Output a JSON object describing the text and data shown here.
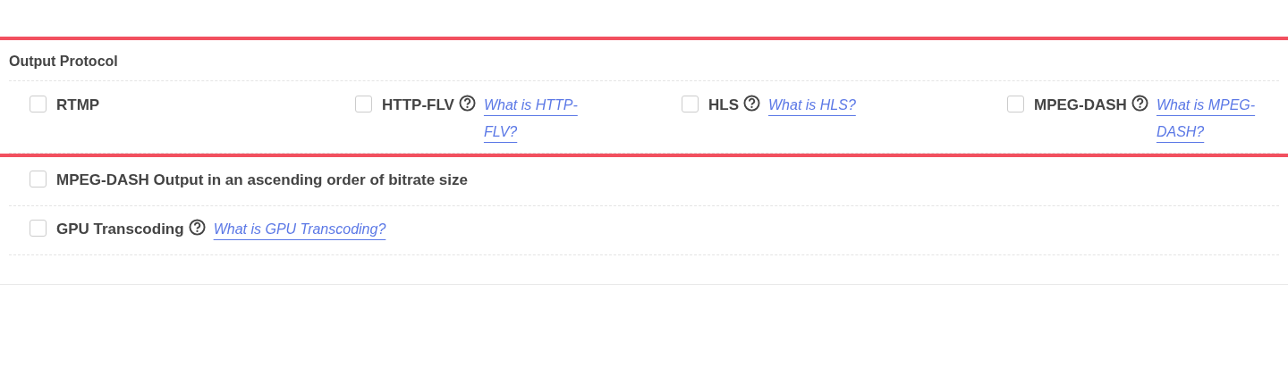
{
  "output_protocol": {
    "title": "Output Protocol",
    "protocols": [
      {
        "label": "RTMP",
        "checked": false
      },
      {
        "label": "HTTP-FLV",
        "checked": false,
        "help_link": "What is HTTP-FLV?"
      },
      {
        "label": "HLS",
        "checked": false,
        "help_link": "What is HLS?"
      },
      {
        "label": "MPEG-DASH",
        "checked": false,
        "help_link": "What is MPEG-DASH?"
      }
    ]
  },
  "options": [
    {
      "label": "MPEG-DASH Output in an ascending order of bitrate size",
      "checked": false
    },
    {
      "label": "GPU Transcoding",
      "checked": false,
      "help_link": "What is GPU Transcoding?"
    }
  ]
}
